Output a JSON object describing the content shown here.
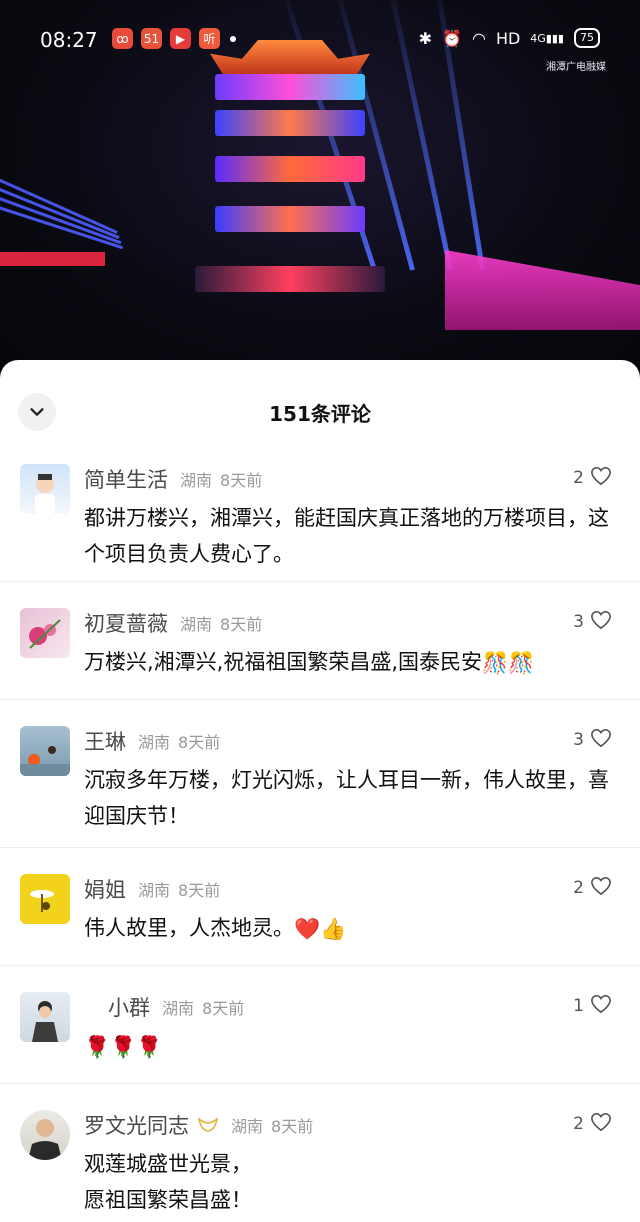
{
  "status_bar": {
    "time": "08:27",
    "app_icons": [
      {
        "name": "qq-music-icon",
        "glyph": "ꝏ",
        "color": "#e84a3c"
      },
      {
        "name": "app-51-icon",
        "glyph": "51",
        "color": "#e8543b"
      },
      {
        "name": "video-play-icon",
        "glyph": "▶",
        "color": "#e63b3b"
      },
      {
        "name": "listen-app-icon",
        "glyph": "听",
        "color": "#ef5a3a"
      }
    ],
    "network": "HD",
    "signal": "4G",
    "battery": "75"
  },
  "video": {
    "watermark": "湘潭广电融媒"
  },
  "sheet": {
    "title": "151条评论",
    "collapse_icon": "chevron-down-icon"
  },
  "comments": [
    {
      "user": "简单生活",
      "location": "湖南",
      "time": "8天前",
      "likes": "2",
      "text": "都讲万楼兴，湘潭兴，能赶国庆真正落地的万楼项目，这个项目负责人费心了。",
      "avatar_colors": [
        "#cfe3f7",
        "#ffffff"
      ]
    },
    {
      "user": "初夏蔷薇",
      "location": "湖南",
      "time": "8天前",
      "likes": "3",
      "text": "万楼兴,湘潭兴,祝福祖国繁荣昌盛,国泰民安",
      "text_emoji": "🎊🎊",
      "avatar_colors": [
        "#e7c1d6",
        "#d83d7c"
      ]
    },
    {
      "user": "王琳",
      "location": "湖南",
      "time": "8天前",
      "likes": "3",
      "text": "沉寂多年万楼，灯光闪烁，让人耳目一新，伟人故里，喜迎国庆节！",
      "avatar_colors": [
        "#9bb6c8",
        "#f05a1a"
      ]
    },
    {
      "user": "娟姐",
      "location": "湖南",
      "time": "8天前",
      "likes": "2",
      "text": "伟人故里，人杰地灵。",
      "text_emoji": "❤️👍",
      "avatar_colors": [
        "#f3d21b",
        "#6e5a12"
      ]
    },
    {
      "user": "小群",
      "location": "湖南",
      "time": "8天前",
      "likes": "1",
      "text": "",
      "text_emoji": "🌹🌹🌹",
      "avatar_colors": [
        "#dfe6ee",
        "#3c3c3c"
      ]
    },
    {
      "user": "罗文光同志",
      "location": "湖南",
      "time": "8天前",
      "likes": "2",
      "text": "观莲城盛世光景，\n愿祖国繁荣昌盛！",
      "vip_badge": true,
      "avatar_colors": [
        "#e4e2de",
        "#2a2a2a"
      ]
    }
  ]
}
